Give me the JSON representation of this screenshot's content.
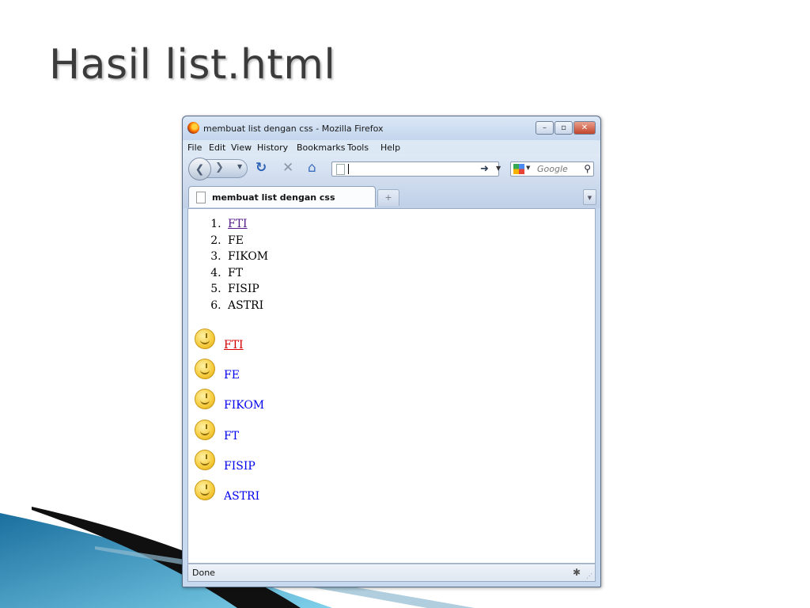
{
  "slide": {
    "title": "Hasil list.html"
  },
  "window": {
    "title": "membuat list dengan css - Mozilla Firefox",
    "controls": {
      "minimize": "–",
      "maximize": "▫",
      "close": "✕"
    }
  },
  "menubar": {
    "items": [
      "File",
      "Edit",
      "View",
      "History",
      "Bookmarks",
      "Tools",
      "Help"
    ]
  },
  "navbar": {
    "url_value": "",
    "search_placeholder": "Google",
    "icons": [
      "back-icon",
      "forward-icon",
      "reload-icon",
      "stop-icon",
      "home-icon",
      "go-icon",
      "search-icon"
    ]
  },
  "tabs": {
    "active": "membuat list dengan css",
    "new_tab": "+"
  },
  "content": {
    "ordered_list": [
      {
        "num": "1.",
        "text": "FTI",
        "state": "visited-link"
      },
      {
        "num": "2.",
        "text": "FE"
      },
      {
        "num": "3.",
        "text": "FIKOM"
      },
      {
        "num": "4.",
        "text": "FT"
      },
      {
        "num": "5.",
        "text": "FISIP"
      },
      {
        "num": "6.",
        "text": "ASTRI"
      }
    ],
    "smiley_list": [
      {
        "text": "FTI",
        "state": "hover-link"
      },
      {
        "text": "FE"
      },
      {
        "text": "FIKOM"
      },
      {
        "text": "FT"
      },
      {
        "text": "FISIP"
      },
      {
        "text": "ASTRI"
      }
    ]
  },
  "status": {
    "text": "Done"
  },
  "colors": {
    "visited": "#551a8b",
    "hover": "#d40000",
    "link": "#0000ee",
    "window_frame": "#c6d9ef"
  }
}
